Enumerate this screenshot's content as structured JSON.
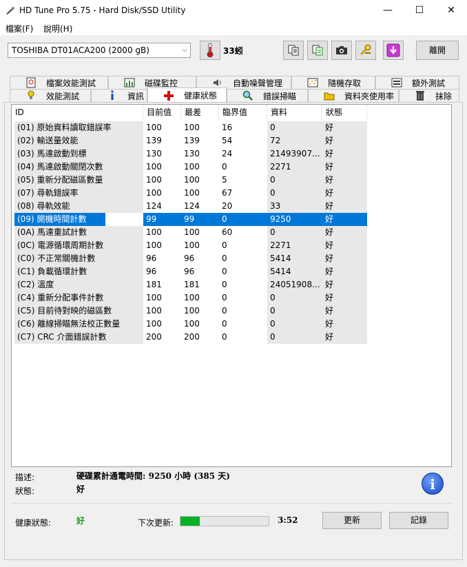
{
  "window": {
    "title": "HD Tune Pro 5.75 - Hard Disk/SSD Utility",
    "minimize": "—",
    "maximize": "☐",
    "close": "✕"
  },
  "menu": [
    "檔案(F)",
    "說明(H)"
  ],
  "toolbar": {
    "drive": "TOSHIBA DT01ACA200 (2000 gB)",
    "temperature": "33蚓",
    "exit_label": "離開"
  },
  "tabs_top": [
    "檔案效能測試",
    "磁碟監控",
    "自動噪聲管理",
    "隨機存取",
    "額外測試"
  ],
  "tabs_bottom": [
    "效能測試",
    "資訊",
    "健康狀態",
    "錯誤掃瞄",
    "資料夾使用率",
    "抹除"
  ],
  "table": {
    "headers": [
      "ID",
      "目前值",
      "最差",
      "臨界值",
      "資料",
      "狀態"
    ],
    "rows": [
      [
        "(01) 原始資料讀取錯誤率",
        "100",
        "100",
        "16",
        "0",
        "好"
      ],
      [
        "(02) 輸送量效能",
        "139",
        "139",
        "54",
        "72",
        "好"
      ],
      [
        "(03) 馬達啟動到標",
        "130",
        "130",
        "24",
        "21493907...",
        "好"
      ],
      [
        "(04) 馬達啟動關閉次數",
        "100",
        "100",
        "0",
        "2271",
        "好"
      ],
      [
        "(05) 重新分配磁區數量",
        "100",
        "100",
        "5",
        "0",
        "好"
      ],
      [
        "(07) 尋軌錯誤率",
        "100",
        "100",
        "67",
        "0",
        "好"
      ],
      [
        "(08) 尋軌效能",
        "124",
        "124",
        "20",
        "33",
        "好"
      ],
      [
        "(09) 開機時間計數",
        "99",
        "99",
        "0",
        "9250",
        "好"
      ],
      [
        "(0A) 馬達重試計數",
        "100",
        "100",
        "60",
        "0",
        "好"
      ],
      [
        "(0C) 電源循環周期計數",
        "100",
        "100",
        "0",
        "2271",
        "好"
      ],
      [
        "(C0) 不正常關機計數",
        "96",
        "96",
        "0",
        "5414",
        "好"
      ],
      [
        "(C1) 負載循環計數",
        "96",
        "96",
        "0",
        "5414",
        "好"
      ],
      [
        "(C2) 溫度",
        "181",
        "181",
        "0",
        "24051908...",
        "好"
      ],
      [
        "(C4) 重新分配事件計數",
        "100",
        "100",
        "0",
        "0",
        "好"
      ],
      [
        "(C5) 目前待對映的磁區數",
        "100",
        "100",
        "0",
        "0",
        "好"
      ],
      [
        "(C6) 離線掃瞄無法校正數量",
        "100",
        "100",
        "0",
        "0",
        "好"
      ],
      [
        "(C7) CRC 介面錯誤計數",
        "200",
        "200",
        "0",
        "0",
        "好"
      ]
    ],
    "selected_index": 7
  },
  "details": {
    "desc_label": "描述:",
    "desc_value": "硬碟累計通電時間: 9250 小時 (385 天)",
    "status_label": "狀態:",
    "status_value": "好"
  },
  "footer": {
    "health_label": "健康狀態:",
    "health_value": "好",
    "next_update_label": "下次更新:",
    "progress_fraction": 0.22,
    "countdown": "3:52",
    "refresh_label": "更新",
    "log_label": "記錄"
  },
  "colors": {
    "selection": "#0078d7",
    "progress": "#06b025",
    "health_ok": "#1a9a1a"
  }
}
